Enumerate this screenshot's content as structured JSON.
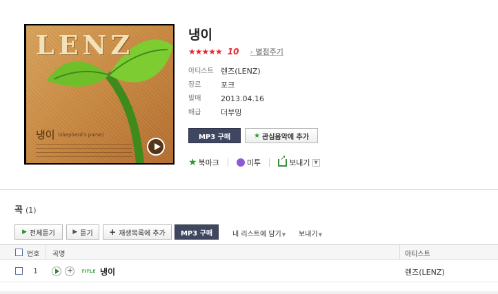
{
  "album": {
    "cover_logo": "LENZ",
    "cover_title": "냉이",
    "cover_subtitle": "(shepherd's purse)",
    "title": "냉이",
    "stars": "★★★★★",
    "rating": "10",
    "rate_link": "별점주기",
    "meta": [
      {
        "key": "아티스트",
        "value": "렌즈(LENZ)"
      },
      {
        "key": "장르",
        "value": "포크"
      },
      {
        "key": "발매",
        "value": "2013.04.16"
      },
      {
        "key": "배급",
        "value": "더부밍"
      }
    ],
    "buy_mp3_label": "MP3 구매",
    "add_fav_label": "관심음악에 추가",
    "bookmark_label": "북마크",
    "metoo_label": "미투",
    "send_label": "보내기"
  },
  "songs_section": {
    "title": "곡",
    "count": "(1)",
    "toolbar": {
      "play_all": "전체듣기",
      "listen": "듣기",
      "add_playlist": "재생목록에 추가",
      "buy_mp3": "MP3 구매",
      "add_my_list": "내 리스트에 담기",
      "send": "보내기"
    },
    "columns": {
      "number": "번호",
      "song": "곡명",
      "artist": "아티스트"
    },
    "rows": [
      {
        "number": "1",
        "badge": "TITLE",
        "name": "냉이",
        "artist": "렌즈(LENZ)"
      }
    ]
  },
  "colors": {
    "rating": "#e8262c",
    "mp3_button": "#3f4660",
    "accent_green": "#2a8f2a"
  }
}
